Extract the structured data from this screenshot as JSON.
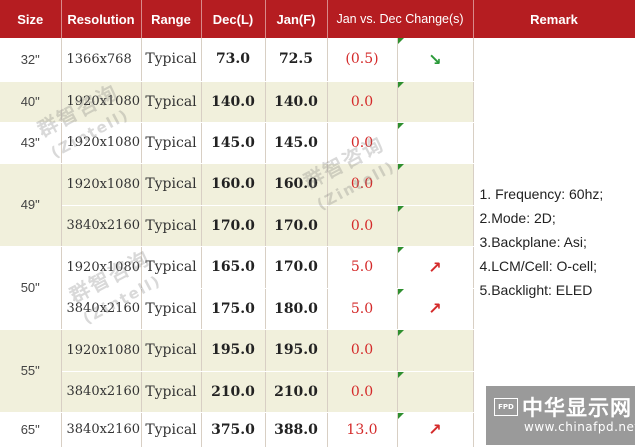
{
  "headers": [
    "Size",
    "Resolution",
    "Range",
    "Dec(L)",
    "Jan(F)",
    "Jan vs. Dec Change(s)",
    "",
    "Remark"
  ],
  "rows": [
    {
      "size": "32\"",
      "resolution": "1366x768",
      "range": "Typical",
      "dec": "73.0",
      "jan": "72.5",
      "change": "(0.5)",
      "trend": "down"
    },
    {
      "size": "40\"",
      "resolution": "1920x1080",
      "range": "Typical",
      "dec": "140.0",
      "jan": "140.0",
      "change": "0.0",
      "trend": "flat"
    },
    {
      "size": "43\"",
      "resolution": "1920x1080",
      "range": "Typical",
      "dec": "145.0",
      "jan": "145.0",
      "change": "0.0",
      "trend": "flat"
    },
    {
      "size": "49\"",
      "resolution": "1920x1080",
      "range": "Typical",
      "dec": "160.0",
      "jan": "160.0",
      "change": "0.0",
      "trend": "flat"
    },
    {
      "size": "",
      "resolution": "3840x2160",
      "range": "Typical",
      "dec": "170.0",
      "jan": "170.0",
      "change": "0.0",
      "trend": "flat"
    },
    {
      "size": "50\"",
      "resolution": "1920x1080",
      "range": "Typical",
      "dec": "165.0",
      "jan": "170.0",
      "change": "5.0",
      "trend": "up"
    },
    {
      "size": "",
      "resolution": "3840x2160",
      "range": "Typical",
      "dec": "175.0",
      "jan": "180.0",
      "change": "5.0",
      "trend": "up"
    },
    {
      "size": "55\"",
      "resolution": "1920x1080",
      "range": "Typical",
      "dec": "195.0",
      "jan": "195.0",
      "change": "0.0",
      "trend": "flat"
    },
    {
      "size": "",
      "resolution": "3840x2160",
      "range": "Typical",
      "dec": "210.0",
      "jan": "210.0",
      "change": "0.0",
      "trend": "flat"
    },
    {
      "size": "65\"",
      "resolution": "3840x2160",
      "range": "Typical",
      "dec": "375.0",
      "jan": "388.0",
      "change": "13.0",
      "trend": "up"
    }
  ],
  "remark": {
    "lines": [
      "1. Frequency: 60hz;",
      "2.Mode: 2D;",
      "3.Backplane: Asi;",
      "4.LCM/Cell: O-cell;",
      "5.Backlight: ELED"
    ]
  },
  "watermark": {
    "chinese": "群智咨询",
    "brand": "(Zintell)"
  },
  "logo": {
    "badge": "FPD",
    "name": "中华显示网",
    "url": "www.chinafpd.net"
  },
  "colors": {
    "header_bg": "#b51d21",
    "row_tint": "#f1f0dc",
    "change_text": "#d42a2a",
    "arrow_up": "#d42a2a",
    "arrow_down": "#2a9a3a",
    "corner_marker": "#2f8f2f"
  }
}
